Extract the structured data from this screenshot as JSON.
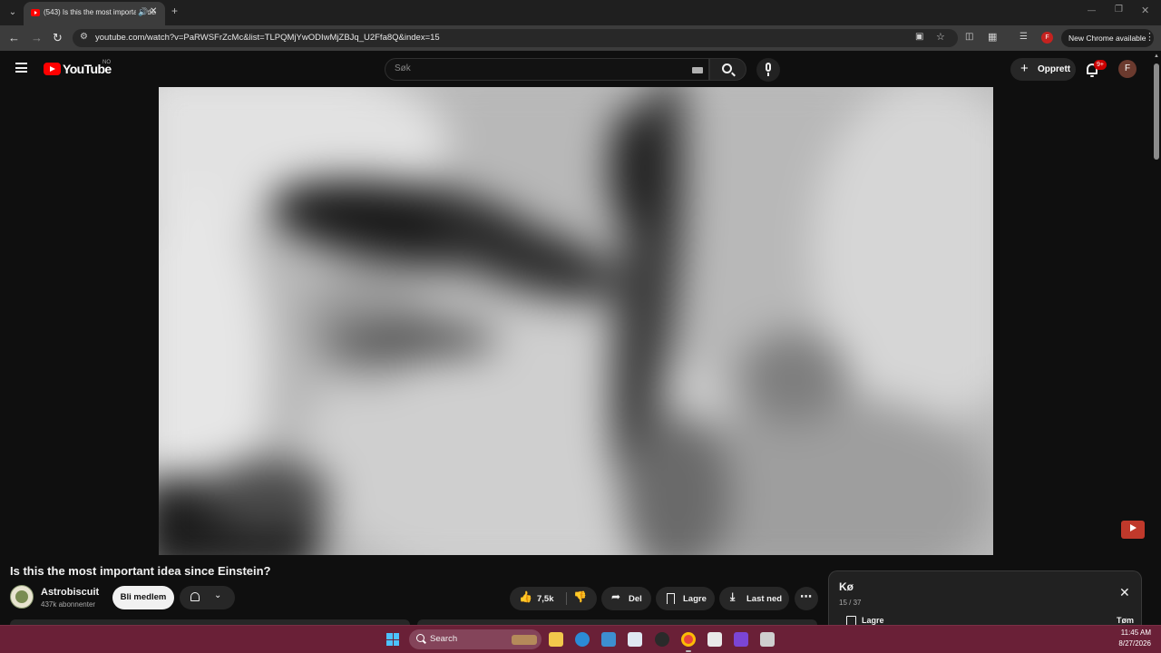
{
  "browser": {
    "tab_title": "(543) Is this the most important idea since Einstein?",
    "url": "youtube.com/watch?v=PaRWSFrZcMc&list=TLPQMjYwODIwMjZBJq_U2Ffa8Q&index=15",
    "new_chrome_label": "New Chrome available",
    "profile_initial": "F"
  },
  "masthead": {
    "logo_text": "YouTube",
    "country_code": "NO",
    "search_placeholder": "Søk",
    "create_label": "Opprett",
    "notification_badge": "9+",
    "avatar_initial": "F"
  },
  "video": {
    "title": "Is this the most important idea since Einstein?",
    "channel_name": "Astrobiscuit",
    "channel_subscribers": "437k abonnenter",
    "join_label": "Bli medlem",
    "like_count": "7,5k",
    "share_label": "Del",
    "save_label": "Lagre",
    "download_label": "Last ned"
  },
  "queue": {
    "title": "Kø",
    "position": "15 / 37",
    "save_label": "Lagre",
    "clear_label": "Tøm"
  },
  "taskbar": {
    "search_label": "Search",
    "time": "11:45 AM",
    "date": "8/27/2026"
  },
  "icons": {
    "tab_audio": "speaker-icon",
    "like": "thumbs-up-icon",
    "dislike": "thumbs-down-icon",
    "share": "share-arrow-icon",
    "download": "download-icon"
  }
}
